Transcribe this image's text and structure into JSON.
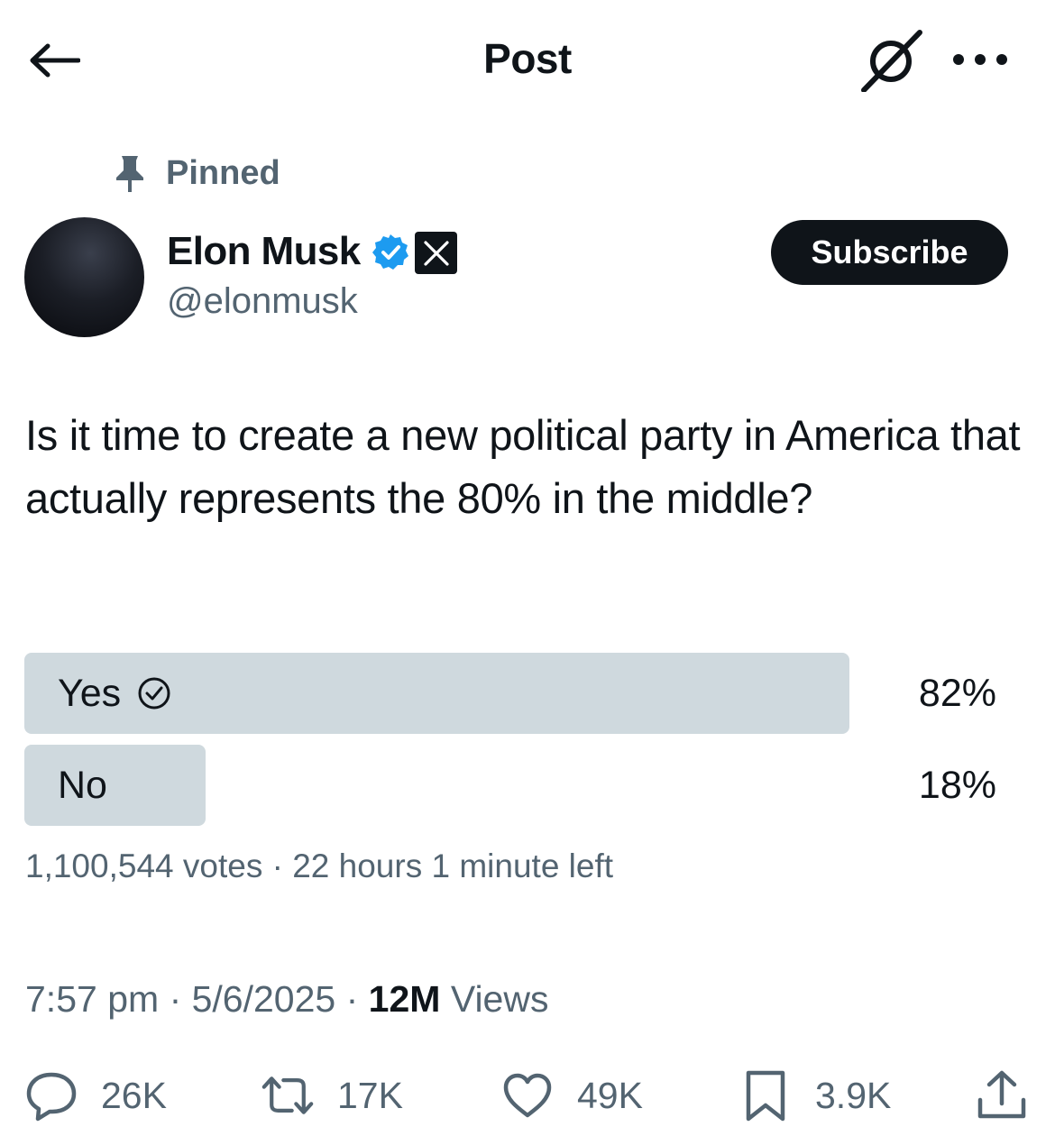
{
  "header": {
    "title": "Post",
    "back_icon": "arrow-left-icon",
    "grok_icon": "grok-icon",
    "more_icon": "more-horizontal-icon"
  },
  "pinned": {
    "label": "Pinned",
    "icon": "pin-icon"
  },
  "author": {
    "name": "Elon Musk",
    "handle": "@elonmusk",
    "verified_color": "#1d9bf0",
    "affiliation_icon": "x-logo-icon"
  },
  "subscribe": {
    "label": "Subscribe"
  },
  "tweet": {
    "text": "Is it time to create a new political party in America that actually represents the 80% in the middle?"
  },
  "poll": {
    "options": [
      {
        "label": "Yes",
        "percent_text": "82%",
        "percent": 82,
        "selected": true
      },
      {
        "label": "No",
        "percent_text": "18%",
        "percent": 18,
        "selected": false
      }
    ],
    "votes": "1,100,544 votes",
    "time_left": "22 hours 1 minute left",
    "bar_color": "#cfd9de"
  },
  "meta": {
    "time": "7:57 pm",
    "date": "5/6/2025",
    "views_count": "12M",
    "views_label": "Views"
  },
  "actions": {
    "replies": "26K",
    "reposts": "17K",
    "likes": "49K",
    "bookmarks": "3.9K"
  },
  "colors": {
    "text": "#0f1419",
    "secondary": "#536471"
  }
}
